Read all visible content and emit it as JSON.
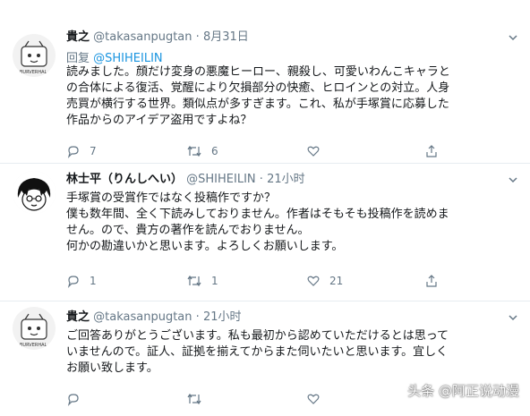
{
  "tweets": [
    {
      "name": "貴之",
      "handle": "@takasanpugtan",
      "dot": "·",
      "time": "8月31日",
      "reply_prefix": "回复",
      "reply_to": "@SHIHEILIN",
      "lines": [
        "読みました。顔だけ変身の悪魔ヒーロー、親殺し、可愛いわんこキャラと",
        "の合体による復活、覚醒により欠損部分の快癒、ヒロインとの対立。人身",
        "売買が横行する世界。類似点が多すぎます。これ、私が手塚賞に応募した",
        "作品からのアイデア盗用ですよね？"
      ],
      "reply_count": "7",
      "retweet_count": "6",
      "like_count": ""
    },
    {
      "name": "林士平（りんしへい）",
      "handle": "@SHIHEILIN",
      "dot": "·",
      "time": "21小时",
      "lines": [
        "手塚賞の受賞作ではなく投稿作ですか？",
        "僕も数年間、全く下読みしておりません。作者はそもそも投稿作を読めま",
        "せん。ので、貴方の著作を読んでおりません。",
        "何かの勘違いかと思います。よろしくお願いします。"
      ],
      "reply_count": "1",
      "retweet_count": "1",
      "like_count": "21"
    },
    {
      "name": "貴之",
      "handle": "@takasanpugtan",
      "dot": "·",
      "time": "21小时",
      "lines": [
        "ご回答ありがとうございます。私も最初から認めていただけるとは思って",
        "いませんので。証人、証拠を揃えてからまた伺いたいと思います。宜しく",
        "お願い致します。"
      ],
      "reply_count": "",
      "retweet_count": "",
      "like_count": ""
    }
  ],
  "watermark": "头条 @阿正说动漫",
  "colors": {
    "text": "#14171a",
    "muted": "#657786",
    "link": "#1b95e0",
    "divider": "#e6ecf0"
  }
}
